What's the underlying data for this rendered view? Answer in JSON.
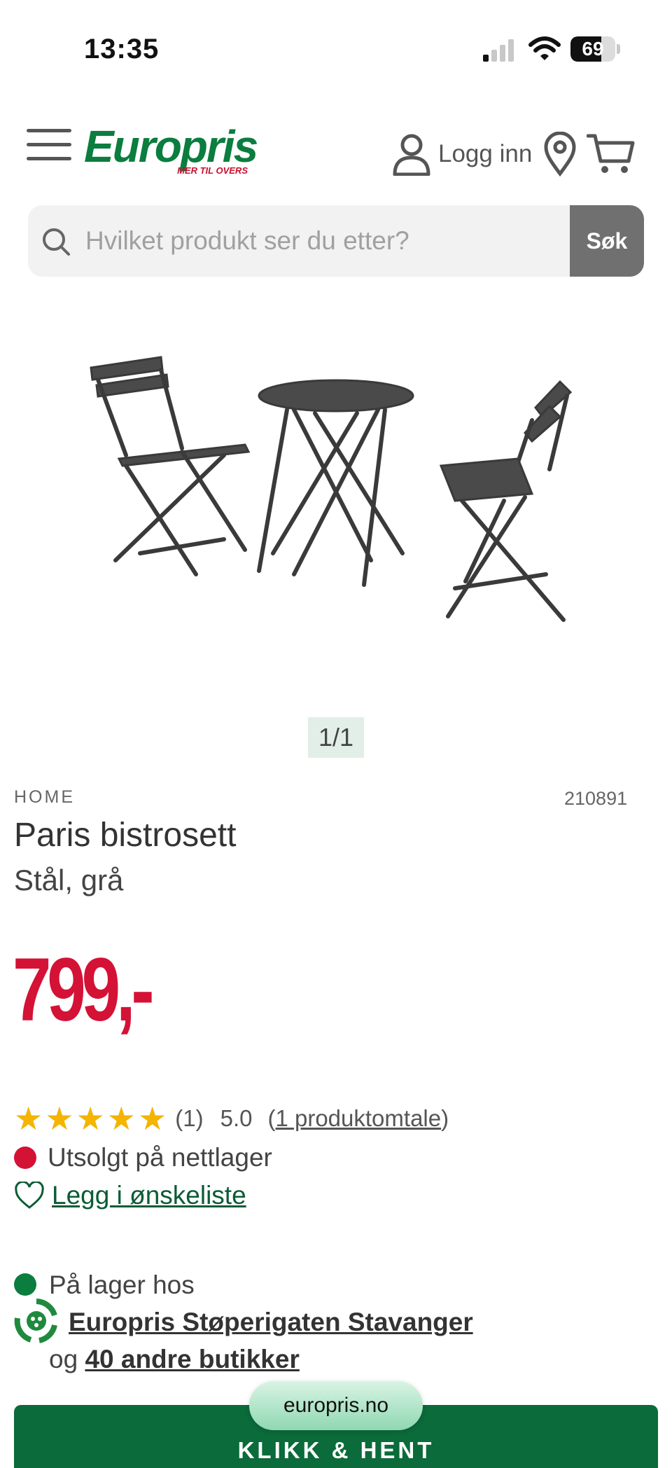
{
  "status_bar": {
    "time": "13:35",
    "battery": "69",
    "battery_level": 0.69
  },
  "header": {
    "logo_text": "Europris",
    "logo_tagline": "MER TIL OVERS",
    "login_label": "Logg inn"
  },
  "search": {
    "placeholder": "Hvilket produkt ser du etter?",
    "button_label": "Søk"
  },
  "gallery": {
    "counter": "1/1"
  },
  "product": {
    "brand": "HOME",
    "sku": "210891",
    "title": "Paris bistrosett",
    "variant": "Stål, grå",
    "price": "799,-",
    "rating_stars": 5,
    "rating_count": "(1)",
    "rating_score": "5.0",
    "review_link": "1 produktomtale",
    "online_stock": "Utsolgt på nettlager",
    "wishlist_label": "Legg i ønskeliste"
  },
  "store_stock": {
    "line1": "På lager hos",
    "store_name": "Europris Støperigaten Stavanger",
    "others_prefix": "og",
    "others_link": "40 andre butikker"
  },
  "footer": {
    "url": "europris.no",
    "cta": "KLIKK & HENT"
  },
  "colors": {
    "brand_green": "#0b7d3e",
    "price_red": "#d41236",
    "star": "#f4b400"
  }
}
